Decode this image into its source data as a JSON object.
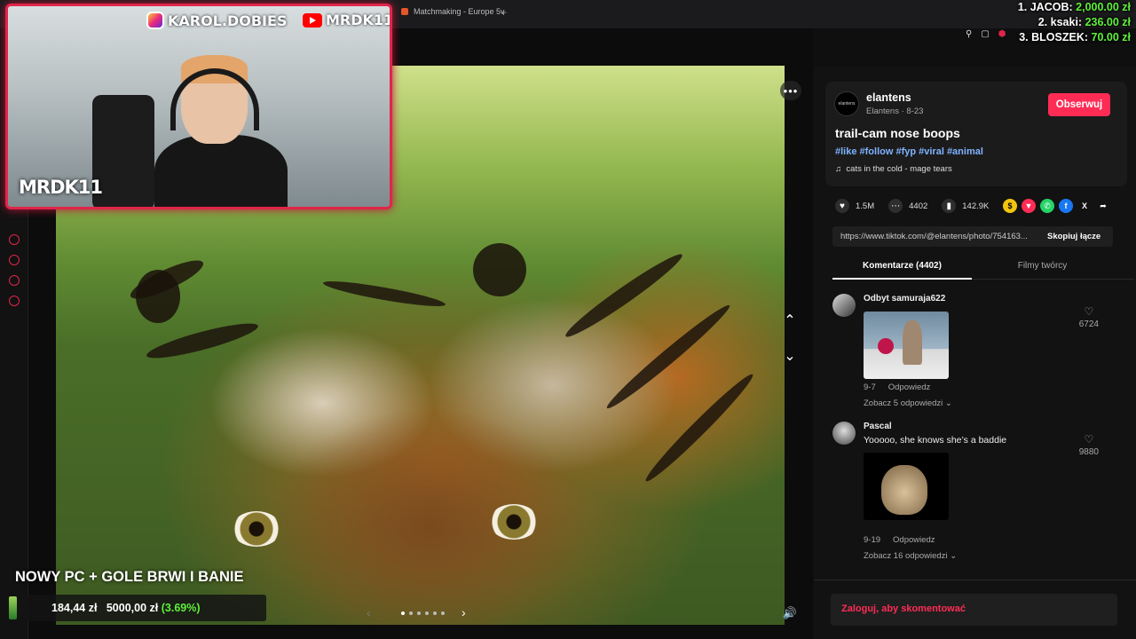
{
  "browser": {
    "tab_title": "Matchmaking - Europe 5v",
    "new_tab": "+"
  },
  "stream_overlay": {
    "instagram": "KAROL.DOBIES",
    "youtube": "MRDK11",
    "cam_name": "MRDK11",
    "title": "NOWY PC + GOLE BRWI I BANIE",
    "goal": {
      "current": "184,44 zł",
      "target": "5000,00 zł",
      "percent": "(3.69%)"
    },
    "leaderboard": [
      {
        "rank_name": "1. JACOB:",
        "amount": "2,000.00 zł"
      },
      {
        "rank_name": "2. ksaki:",
        "amount": "236.00 zł"
      },
      {
        "rank_name": "3. BLOSZEK:",
        "amount": "70.00 zł"
      }
    ]
  },
  "media": {
    "more_label": "•••",
    "carousel_dots": 6,
    "carousel_active": 0
  },
  "post": {
    "avatar_text": "elantens",
    "username": "elantens",
    "subline": "Elantens · 8-23",
    "follow_label": "Obserwuj",
    "title": "trail-cam nose boops",
    "tags": "#like #follow #fyp #viral #animal",
    "music": "cats in the cold - mage tears",
    "likes": "1.5M",
    "comments": "4402",
    "saves": "142.9K",
    "link_url": "https://www.tiktok.com/@elantens/photo/754163...",
    "copy_label": "Skopiuj łącze"
  },
  "tabs": {
    "comments": "Komentarze (4402)",
    "creator_videos": "Filmy twórcy"
  },
  "comments": [
    {
      "user": "Odbyt samuraja622",
      "text": "",
      "date": "9-7",
      "reply": "Odpowiedz",
      "likes": "6724",
      "replies": "Zobacz 5 odpowiedzi"
    },
    {
      "user": "Pascal",
      "text": "Yooooo, she knows she’s a baddie",
      "date": "9-19",
      "reply": "Odpowiedz",
      "likes": "9880",
      "replies": "Zobacz 16 odpowiedzi"
    }
  ],
  "login_prompt": "Zaloguj, aby skomentować",
  "colors": {
    "accent": "#fe2c55",
    "overlay_red": "#e0254a",
    "money_green": "#5ff03a"
  }
}
